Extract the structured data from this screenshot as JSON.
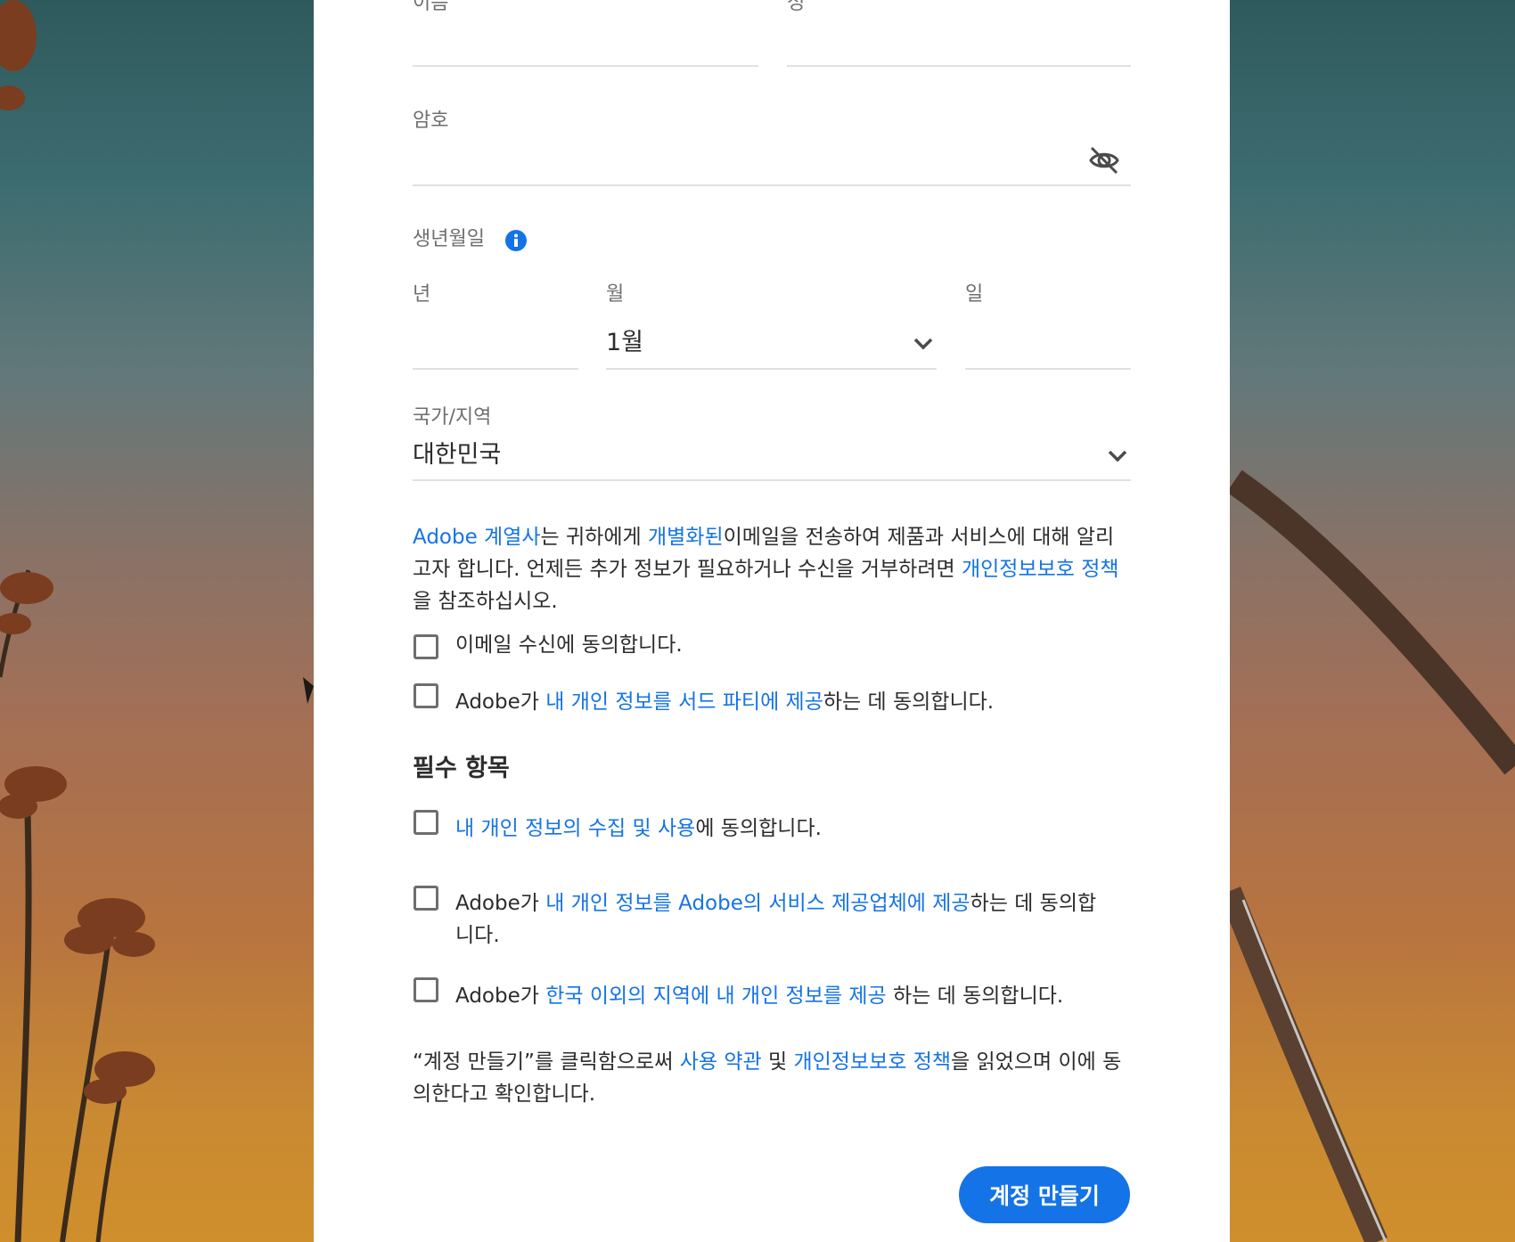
{
  "form": {
    "first_name_label": "이름",
    "last_name_label": "성",
    "password_label": "암호",
    "password_toggle_icon": "eye-slash-icon",
    "birthdate_label": "생년월일",
    "birthdate_info_icon": "info-icon",
    "year_label": "년",
    "month_label": "월",
    "month_value": "1월",
    "day_label": "일",
    "country_label": "국가/지역",
    "country_value": "대한민국"
  },
  "marketing": {
    "p_link1": "Adobe 계열사",
    "p_text1": "는 귀하에게 ",
    "p_link2": "개별화된",
    "p_text2": "이메일을 전송하여 제품과 서비스에 대해 알리고자 합니다. 언제든 추가 정보가 필요하거나 수신을 거부하려면 ",
    "p_link3": "개인정보보호 정책",
    "p_text3": " 을 참조하십시오.",
    "email_consent": "이메일 수신에 동의합니다.",
    "third_party_pre": "Adobe가 ",
    "third_party_link": "내 개인 정보를 서드 파티에 제공",
    "third_party_post": "하는 데 동의합니다."
  },
  "required": {
    "title": "필수 항목",
    "c1_link": "내 개인 정보의 수집 및 사용",
    "c1_post": "에 동의합니다.",
    "c2_pre": "Adobe가 ",
    "c2_link": "내 개인 정보를 Adobe의 서비스 제공업체에 제공",
    "c2_post": "하는 데 동의합니다.",
    "c3_pre": "Adobe가 ",
    "c3_link": "한국 이외의 지역에 내 개인 정보를 제공",
    "c3_post": " 하는 데 동의합니다."
  },
  "terms": {
    "t_pre": "“계정 만들기”를 클릭함으로써 ",
    "t_link1": "사용 약관",
    "t_mid": " 및 ",
    "t_link2": "개인정보보호 정책",
    "t_post": "을 읽었으며 이에 동의한다고 확인합니다."
  },
  "submit_label": "계정 만들기",
  "colors": {
    "link": "#1473e6",
    "button": "#1473e6"
  }
}
